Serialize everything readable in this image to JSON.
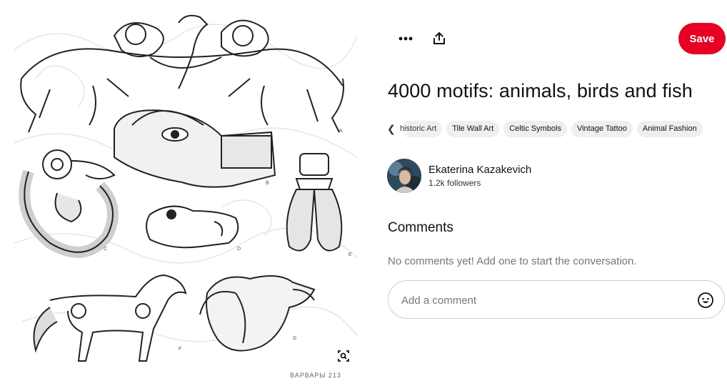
{
  "pin": {
    "title": "4000 motifs: animals, birds and fish",
    "image_caption": "ВАРВАРЫ   213",
    "image_letters": [
      "A",
      "B",
      "C",
      "D",
      "E",
      "F",
      "G"
    ]
  },
  "actions": {
    "more_icon": "ellipsis-icon",
    "share_icon": "share-icon",
    "save_label": "Save",
    "save_color": "#e60023"
  },
  "tags": [
    "historic Art",
    "Tile Wall Art",
    "Celtic Symbols",
    "Vintage Tattoo",
    "Animal Fashion"
  ],
  "creator": {
    "name": "Ekaterina Kazakevich",
    "followers": "1.2k followers"
  },
  "comments": {
    "heading": "Comments",
    "empty_text": "No comments yet! Add one to start the conversation.",
    "placeholder": "Add a comment"
  }
}
